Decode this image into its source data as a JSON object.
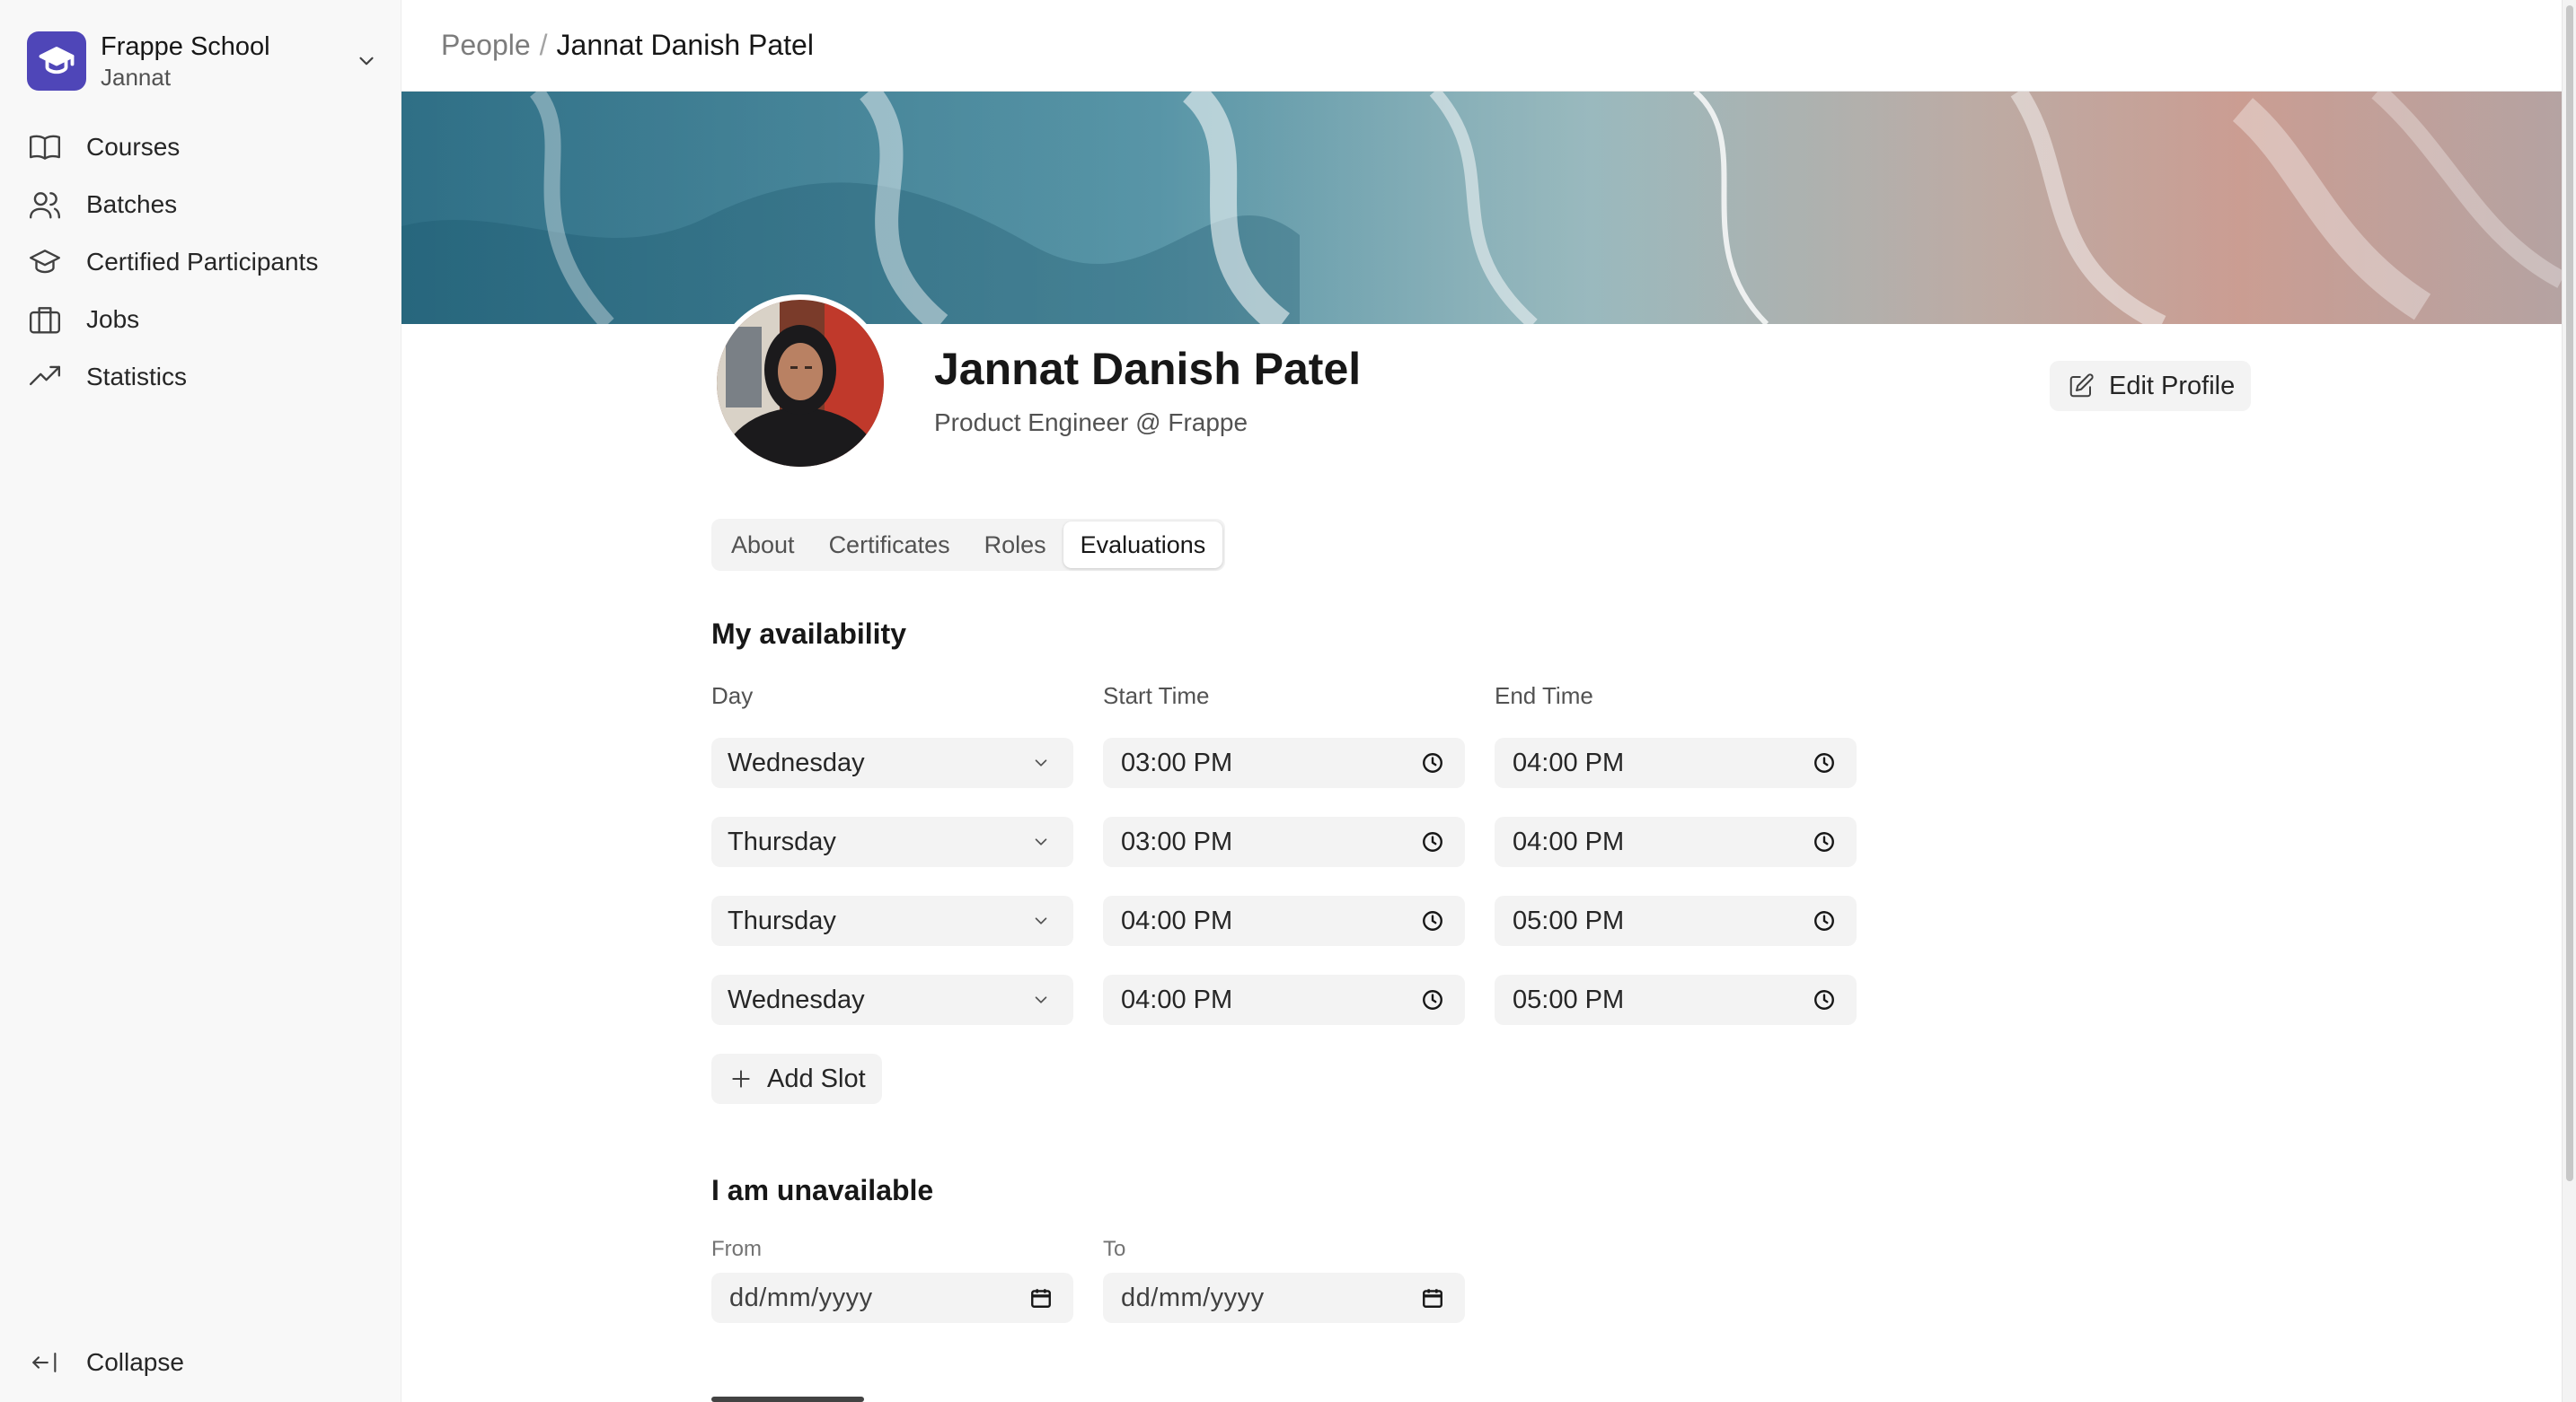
{
  "sidebar": {
    "brand_name": "Frappe School",
    "brand_user": "Jannat",
    "items": [
      {
        "label": "Courses",
        "icon": "book-icon"
      },
      {
        "label": "Batches",
        "icon": "users-icon"
      },
      {
        "label": "Certified Participants",
        "icon": "graduation-cap-icon"
      },
      {
        "label": "Jobs",
        "icon": "briefcase-icon"
      },
      {
        "label": "Statistics",
        "icon": "trending-up-icon"
      }
    ],
    "collapse_label": "Collapse"
  },
  "breadcrumb": {
    "parent": "People",
    "separator": "/",
    "current": "Jannat Danish Patel"
  },
  "profile": {
    "name": "Jannat Danish Patel",
    "headline": "Product Engineer @ Frappe",
    "edit_label": "Edit Profile"
  },
  "tabs": [
    {
      "label": "About",
      "active": false
    },
    {
      "label": "Certificates",
      "active": false
    },
    {
      "label": "Roles",
      "active": false
    },
    {
      "label": "Evaluations",
      "active": true
    }
  ],
  "availability": {
    "title": "My availability",
    "columns": {
      "day": "Day",
      "start": "Start Time",
      "end": "End Time"
    },
    "slots": [
      {
        "day": "Wednesday",
        "start": "03:00 PM",
        "end": "04:00 PM"
      },
      {
        "day": "Thursday",
        "start": "03:00 PM",
        "end": "04:00 PM"
      },
      {
        "day": "Thursday",
        "start": "04:00 PM",
        "end": "05:00 PM"
      },
      {
        "day": "Wednesday",
        "start": "04:00 PM",
        "end": "05:00 PM"
      }
    ],
    "add_slot_label": "Add Slot"
  },
  "unavailable": {
    "title": "I am unavailable",
    "from_label": "From",
    "to_label": "To",
    "from_value": "dd/mm/yyyy",
    "to_value": "dd/mm/yyyy"
  },
  "colors": {
    "brand": "#4f46b8",
    "sidebar_bg": "#f8f8f8",
    "field_bg": "#f3f3f3"
  }
}
